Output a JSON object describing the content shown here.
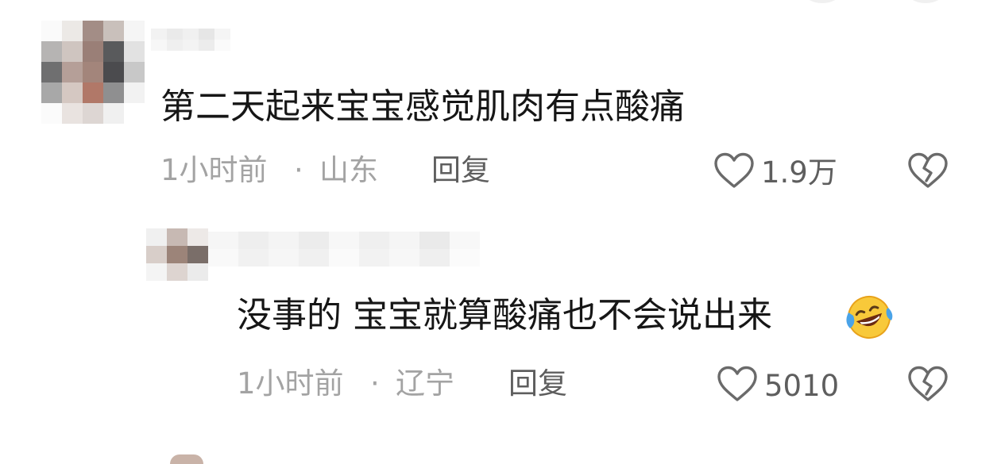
{
  "comments": [
    {
      "text": "第二天起来宝宝感觉肌肉有点酸痛",
      "time": "1小时前",
      "location": "山东",
      "separator": "·",
      "reply_label": "回复",
      "likes": "1.9万"
    },
    {
      "text": "没事的 宝宝就算酸痛也不会说出来",
      "emoji": "rolling-on-floor-laughing",
      "time": "1小时前",
      "location": "辽宁",
      "separator": "·",
      "reply_label": "回复",
      "likes": "5010"
    }
  ],
  "colors": {
    "text": "#161616",
    "meta": "#a3a3a3",
    "action": "#5e5e5e",
    "icon": "#6a6a6a"
  },
  "icons": {
    "like": "heart-outline-icon",
    "dislike": "broken-heart-icon",
    "emoji": "rolling-laughing-emoji"
  }
}
